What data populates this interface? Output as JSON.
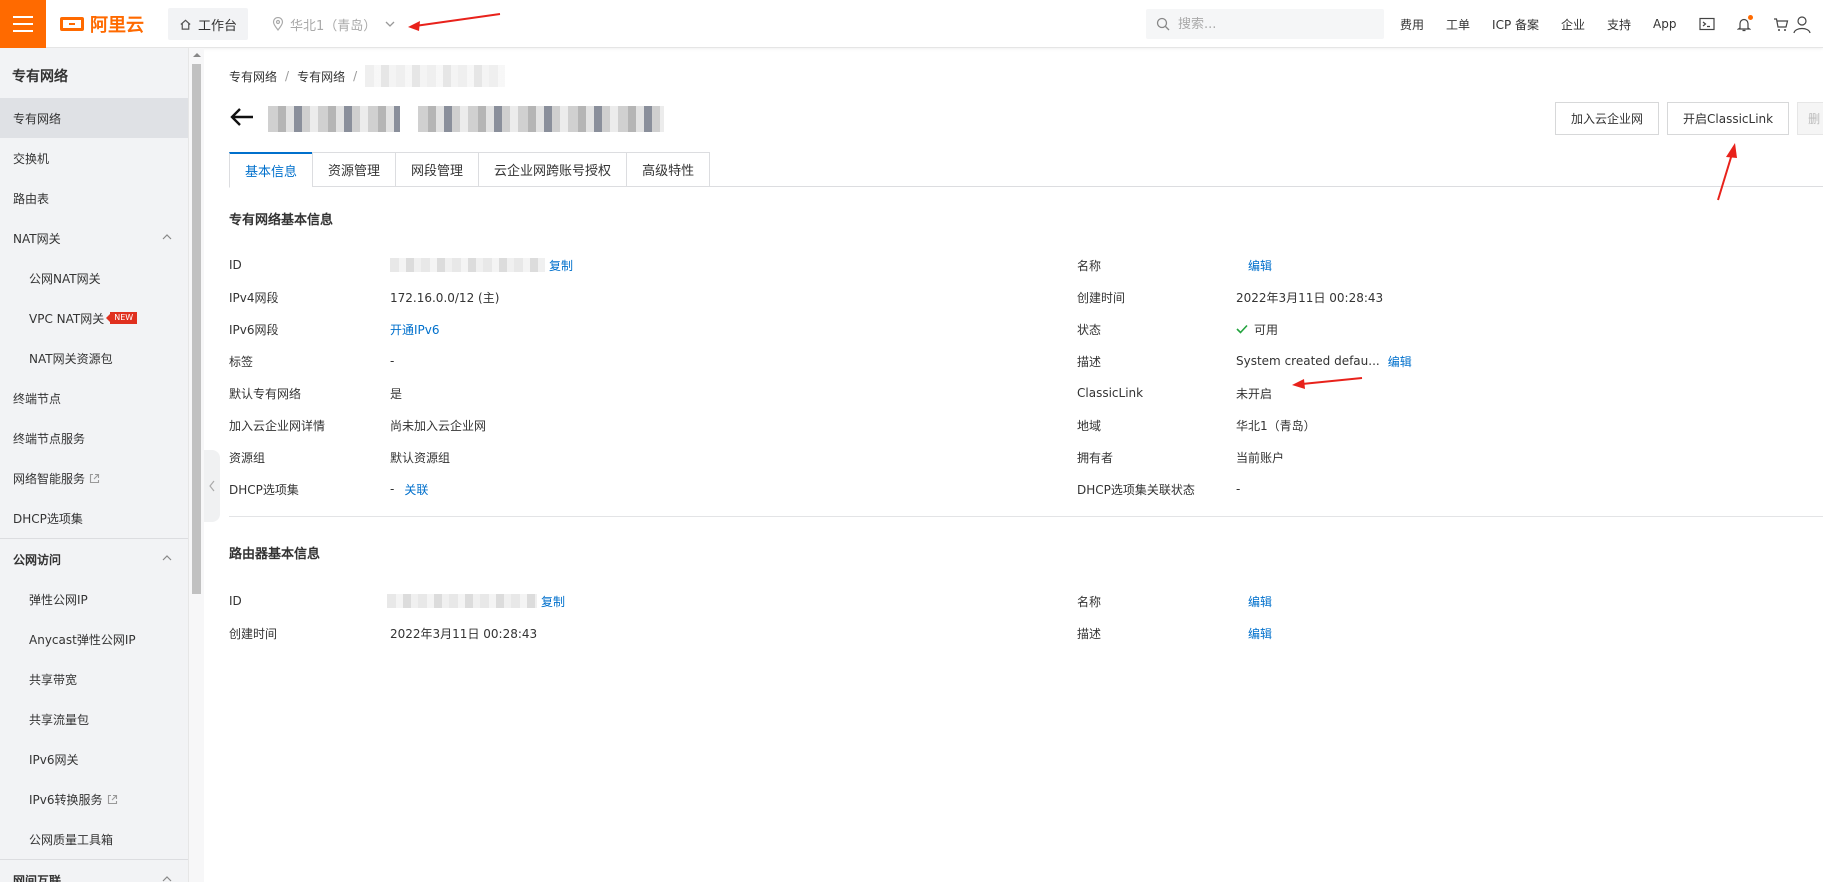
{
  "topbar": {
    "logo_text": "阿里云",
    "workbench_label": "工作台",
    "region_label": "华北1（青岛）",
    "search_placeholder": "搜索...",
    "nav": [
      "费用",
      "工单",
      "ICP 备案",
      "企业",
      "支持",
      "App"
    ],
    "brand_color": "#ff6a00"
  },
  "sidebar": {
    "title": "专有网络",
    "items": [
      {
        "label": "专有网络",
        "active": true
      },
      {
        "label": "交换机"
      },
      {
        "label": "路由表"
      },
      {
        "label": "NAT网关",
        "expanded": true
      },
      {
        "label": "公网NAT网关",
        "sub": true
      },
      {
        "label": "VPC NAT网关",
        "sub": true,
        "badge": "NEW"
      },
      {
        "label": "NAT网关资源包",
        "sub": true
      },
      {
        "label": "终端节点"
      },
      {
        "label": "终端节点服务"
      },
      {
        "label": "网络智能服务",
        "external": true
      },
      {
        "label": "DHCP选项集"
      },
      {
        "label": "公网访问",
        "expanded": true
      },
      {
        "label": "弹性公网IP",
        "sub": true
      },
      {
        "label": "Anycast弹性公网IP",
        "sub": true
      },
      {
        "label": "共享带宽",
        "sub": true
      },
      {
        "label": "共享流量包",
        "sub": true
      },
      {
        "label": "IPv6网关",
        "sub": true
      },
      {
        "label": "IPv6转换服务",
        "sub": true,
        "external": true
      },
      {
        "label": "公网质量工具箱",
        "sub": true
      },
      {
        "label": "网间互联",
        "expanded": true
      }
    ]
  },
  "breadcrumb": [
    "专有网络",
    "专有网络"
  ],
  "header_buttons": [
    "加入云企业网",
    "开启ClassicLink",
    "删"
  ],
  "tabs": [
    "基本信息",
    "资源管理",
    "网段管理",
    "云企业网跨账号授权",
    "高级特性"
  ],
  "vpc_info": {
    "title": "专有网络基本信息",
    "left": [
      {
        "label": "ID",
        "value": "",
        "link": "复制"
      },
      {
        "label": "IPv4网段",
        "value": "172.16.0.0/12 (主)"
      },
      {
        "label": "IPv6网段",
        "value": "",
        "link": "开通IPv6"
      },
      {
        "label": "标签",
        "value": "-"
      },
      {
        "label": "默认专有网络",
        "value": "是"
      },
      {
        "label": "加入云企业网详情",
        "value": "尚未加入云企业网"
      },
      {
        "label": "资源组",
        "value": "默认资源组"
      },
      {
        "label": "DHCP选项集",
        "value": "-",
        "link": "关联"
      }
    ],
    "right": [
      {
        "label": "名称",
        "value": "",
        "link": "编辑"
      },
      {
        "label": "创建时间",
        "value": "2022年3月11日 00:28:43"
      },
      {
        "label": "状态",
        "value": "可用"
      },
      {
        "label": "描述",
        "value": "System created defau...",
        "link": "编辑"
      },
      {
        "label": "ClassicLink",
        "value": "未开启"
      },
      {
        "label": "地域",
        "value": "华北1（青岛）"
      },
      {
        "label": "拥有者",
        "value": "当前账户"
      },
      {
        "label": "DHCP选项集关联状态",
        "value": "-"
      }
    ]
  },
  "router_info": {
    "title": "路由器基本信息",
    "left": [
      {
        "label": "ID",
        "value": "",
        "link": "复制"
      },
      {
        "label": "创建时间",
        "value": "2022年3月11日 00:28:43"
      }
    ],
    "right": [
      {
        "label": "名称",
        "value": "",
        "link": "编辑"
      },
      {
        "label": "描述",
        "value": "",
        "link": "编辑"
      }
    ]
  },
  "colors": {
    "link": "#0070cc",
    "success": "#23a33e",
    "annotation": "#e8221b"
  }
}
